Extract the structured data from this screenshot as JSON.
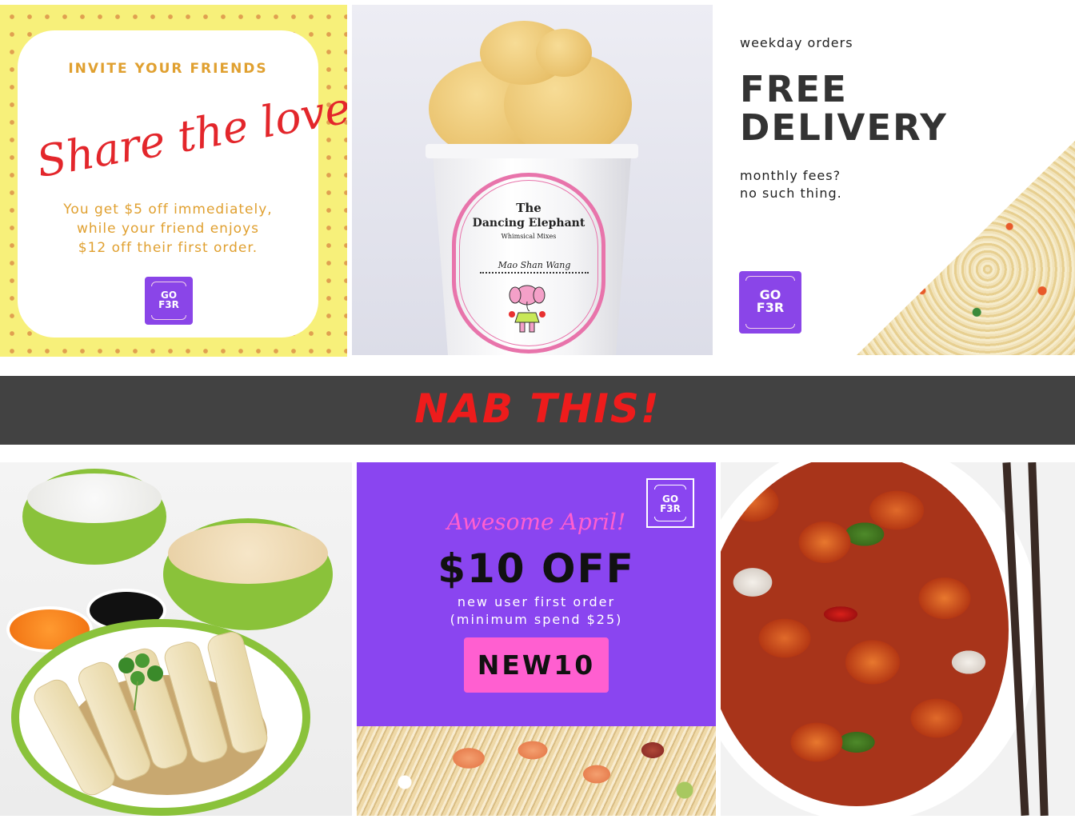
{
  "tiles": {
    "share": {
      "heading": "INVITE YOUR FRIENDS",
      "script": "Share the love",
      "offer_line1": "You get $5 off immediately,",
      "offer_line2": "while your friend enjoys",
      "offer_line3": "$12 off their first order.",
      "logo_line1": "GO",
      "logo_line2": "F3R"
    },
    "icecream": {
      "brand_line1": "The",
      "brand_line2": "Dancing Elephant",
      "brand_line3": "Whimsical Mixes",
      "flavour": "Mao Shan Wang"
    },
    "delivery": {
      "eyebrow": "weekday orders",
      "headline_line1": "FREE",
      "headline_line2": "DELIVERY",
      "sub_line1": "monthly fees?",
      "sub_line2": "no such thing.",
      "logo_line1": "GO",
      "logo_line2": "F3R"
    },
    "promo": {
      "script": "Awesome April!",
      "amount": "$10 OFF",
      "line1": "new user first order",
      "line2": "(minimum spend $25)",
      "code": "NEW10",
      "logo_line1": "GO",
      "logo_line2": "F3R"
    }
  },
  "banner": {
    "text": "NAB THIS!"
  },
  "colors": {
    "brand_purple": "#8a45e8",
    "promo_pink": "#ff5fd0",
    "banner_bg": "#424242",
    "banner_text": "#ee1c1c",
    "share_red": "#e3262b",
    "share_gold": "#e0a030"
  }
}
